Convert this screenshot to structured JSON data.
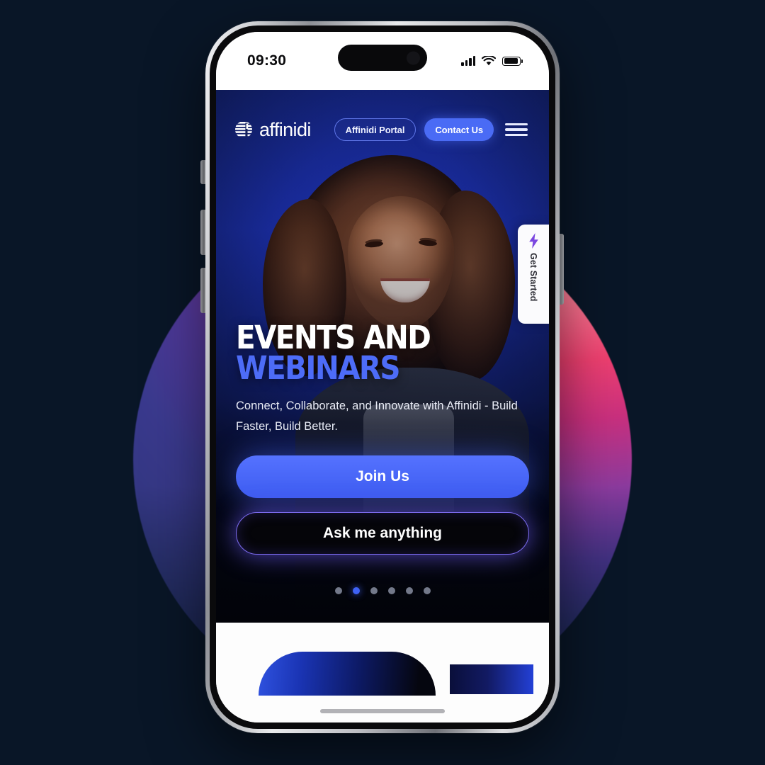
{
  "device": {
    "name": "iphone-mockup",
    "status_bar": {
      "time": "09:30",
      "icons": [
        "cellular-signal-icon",
        "wifi-icon",
        "battery-icon"
      ]
    },
    "home_indicator": "home-indicator-bar"
  },
  "site": {
    "nav": {
      "logo_text": "affinidi",
      "logo_icon": "affinidi-logo-mark",
      "portal_button": "Affinidi Portal",
      "contact_button": "Contact Us",
      "menu_icon": "hamburger-menu-icon"
    },
    "side_tab": {
      "label": "Get Started",
      "icon": "lightning-bolt-icon"
    },
    "hero": {
      "headline_line1": "EVENTS AND",
      "headline_line2": "WEBINARS",
      "subcopy": "Connect, Collaborate, and Innovate with Affinidi - Build Faster, Build Better.",
      "primary_cta": "Join Us",
      "secondary_cta": "Ask me anything",
      "carousel": {
        "total": 6,
        "active_index": 2
      }
    }
  },
  "colors": {
    "page_background": "#091627",
    "brand_blue": "#4a6bf5",
    "headline_blue": "#4d6cf7",
    "hero_blue": "#1b2ea8",
    "glow_purple": "#7d6cf0",
    "circle_pink": "#ef4070",
    "circle_purple": "#53399c"
  }
}
